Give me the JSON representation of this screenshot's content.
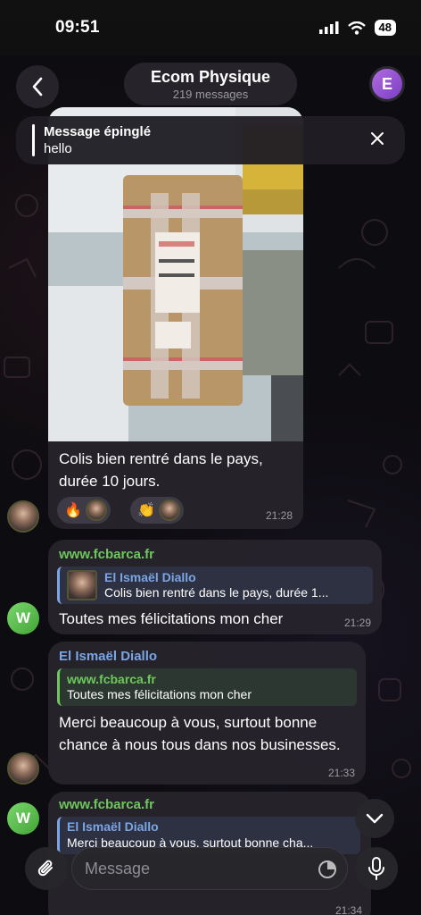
{
  "status_bar": {
    "time": "09:51",
    "battery": "48"
  },
  "header": {
    "title": "Ecom Physique",
    "subtitle": "219 messages",
    "group_avatar_letter": "E"
  },
  "pinned": {
    "title": "Message épinglé",
    "text": "hello"
  },
  "messages": [
    {
      "text": "Colis bien rentré dans le pays, durée 10 jours.",
      "time": "21:28",
      "reactions": [
        "🔥",
        "👏"
      ]
    },
    {
      "sender": "www.fcbarca.fr",
      "reply_name": "El Ismaël Diallo",
      "reply_text": "Colis bien rentré dans le pays, durée 1...",
      "text": "Toutes mes félicitations mon cher",
      "time": "21:29",
      "avatar_letter": "W"
    },
    {
      "sender": "El Ismaël Diallo",
      "reply_name": "www.fcbarca.fr",
      "reply_text": "Toutes mes félicitations mon cher",
      "text": "Merci beaucoup à vous, surtout bonne chance à nous tous dans nos businesses.",
      "time": "21:33"
    },
    {
      "sender": "www.fcbarca.fr",
      "reply_name": "El Ismaël Diallo",
      "reply_text": "Merci beaucoup à vous, surtout bonne cha...",
      "time": "21:34",
      "avatar_letter": "W"
    }
  ],
  "input": {
    "placeholder": "Message"
  },
  "colors": {
    "site_green": "#6ec85c",
    "name_blue": "#7aa5e6",
    "bubble": "#26232c"
  }
}
